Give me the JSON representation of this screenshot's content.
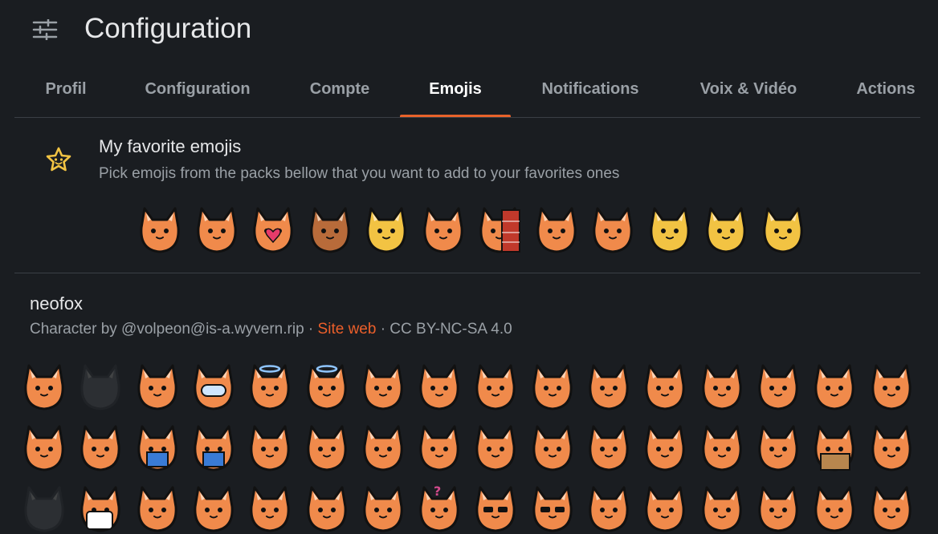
{
  "header": {
    "title": "Configuration",
    "icon": "sliders-icon"
  },
  "tabs": [
    {
      "label": "Profil",
      "active": false
    },
    {
      "label": "Configuration",
      "active": false
    },
    {
      "label": "Compte",
      "active": false
    },
    {
      "label": "Emojis",
      "active": true
    },
    {
      "label": "Notifications",
      "active": false
    },
    {
      "label": "Voix & Vidéo",
      "active": false
    },
    {
      "label": "Actions",
      "active": false
    }
  ],
  "favorites": {
    "title": "My favorite emojis",
    "description": "Pick emojis from the packs bellow that you want to add to your favorites ones",
    "icon": "star-face-icon",
    "emojis": [
      {
        "variant": "happy",
        "color": "#f08a4b"
      },
      {
        "variant": "fluffy",
        "color": "#f08a4b"
      },
      {
        "variant": "heart",
        "color": "#f08a4b"
      },
      {
        "variant": "sparkle",
        "color": "#b86b3a"
      },
      {
        "variant": "egg",
        "color": "#f2c343"
      },
      {
        "variant": "smile",
        "color": "#f08a4b"
      },
      {
        "variant": "wall",
        "color": "#f08a4b"
      },
      {
        "variant": "sad",
        "color": "#f08a4b"
      },
      {
        "variant": "scared",
        "color": "#f08a4b"
      },
      {
        "variant": "think",
        "color": "#f2c343"
      },
      {
        "variant": "squint",
        "color": "#f2c343"
      },
      {
        "variant": "shout",
        "color": "#f2c343"
      }
    ]
  },
  "pack": {
    "name": "neofox",
    "credits_prefix": "Character by @volpeon@is-a.wyvern.rip · ",
    "site_link": "Site web",
    "license": " · CC BY-NC-SA 4.0",
    "accent_color": "#ec5f2a",
    "emoji_rows": [
      [
        "bluehair",
        "ghost",
        "think",
        "amogus",
        "angel",
        "angelsad",
        "angry",
        "point",
        "astronaut",
        "astronaut-point",
        "cry-hands",
        "surprised",
        "blank",
        "smile",
        "squint",
        "facepalm"
      ],
      [
        "lying",
        "lying-flat",
        "book",
        "book-read",
        "blep",
        "blep2",
        "blep3",
        "blep-x",
        "blep4",
        "blep5",
        "blep-blue",
        "blep6",
        "blep7",
        "wink-hands",
        "box",
        "yellow-wut"
      ],
      [
        "ghost2",
        "mug",
        "hood",
        "hood2",
        "hood3",
        "hood4",
        "hood5",
        "question",
        "shades",
        "shades2",
        "ooh",
        "cry",
        "glasses-up",
        "eyes",
        "devil",
        "dizzy"
      ]
    ]
  },
  "colors": {
    "background": "#1a1d21",
    "text": "#e6e7e9",
    "muted": "#9aa0a6",
    "accent": "#e8622a",
    "divider": "#3a3f45",
    "fox": "#f08a4b",
    "yellow": "#f2c343"
  }
}
